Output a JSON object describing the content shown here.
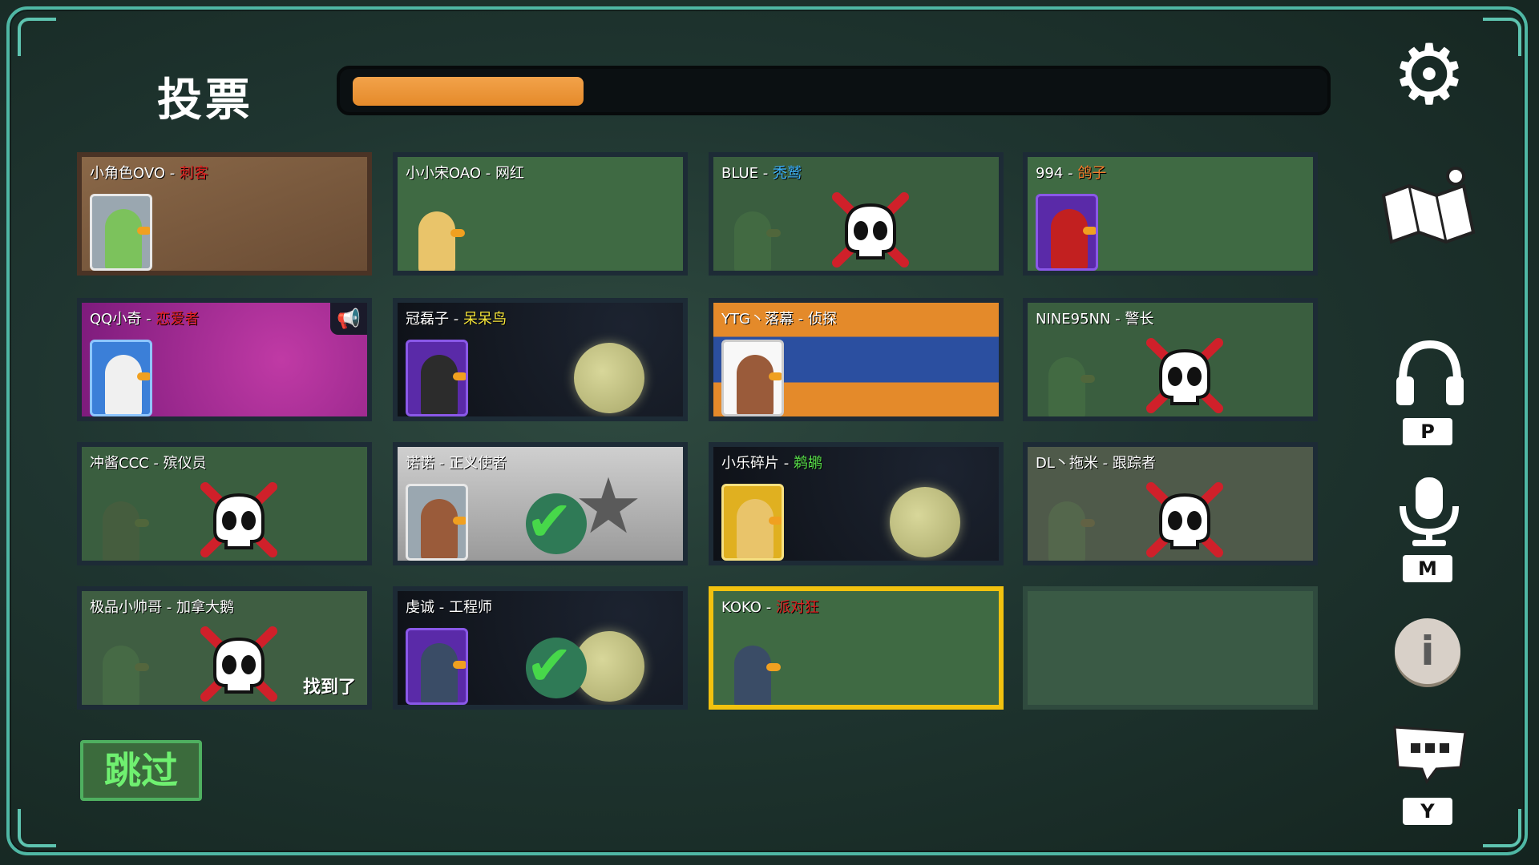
{
  "title": "投票",
  "timer": {
    "progress": 0.24
  },
  "skip_label": "跳过",
  "keys": {
    "p": "P",
    "m": "M",
    "y": "Y"
  },
  "info_glyph": "i",
  "players": [
    {
      "name": "小角色OVO",
      "sep": " - ",
      "role": "刺客",
      "role_color": "red"
    },
    {
      "name": "小小宋OAO",
      "sep": " - ",
      "role": "网红",
      "role_color": "white"
    },
    {
      "name": "BLUE",
      "sep": " - ",
      "role": "秃鹫",
      "role_color": "blue"
    },
    {
      "name": "994",
      "sep": " - ",
      "role": "鸽子",
      "role_color": "orange"
    },
    {
      "name": "QQ小奇",
      "sep": " - ",
      "role": "恋爱者",
      "role_color": "red"
    },
    {
      "name": "冠磊子",
      "sep": " - ",
      "role": "呆呆鸟",
      "role_color": "yellow"
    },
    {
      "name": "YTG丶落幕",
      "sep": " - ",
      "role": "侦探",
      "role_color": "white"
    },
    {
      "name": "NINE95NN",
      "sep": " - ",
      "role": "警长",
      "role_color": "white"
    },
    {
      "name": "冲酱CCC",
      "sep": " - ",
      "role": "殡仪员",
      "role_color": "white"
    },
    {
      "name": "诺诺",
      "sep": " - ",
      "role": "正义使者",
      "role_color": "white"
    },
    {
      "name": "小乐碎片",
      "sep": " - ",
      "role": "鹈鹕",
      "role_color": "green"
    },
    {
      "name": "DL丶拖米",
      "sep": " - ",
      "role": "跟踪者",
      "role_color": "white"
    },
    {
      "name": "极品小帅哥",
      "sep": " - ",
      "role": "加拿大鹅",
      "role_color": "white"
    },
    {
      "name": "虔诚",
      "sep": " - ",
      "role": "工程师",
      "role_color": "white"
    },
    {
      "name": "KOKO",
      "sep": " - ",
      "role": "派对狂",
      "role_color": "red"
    }
  ],
  "found_label": "找到了"
}
